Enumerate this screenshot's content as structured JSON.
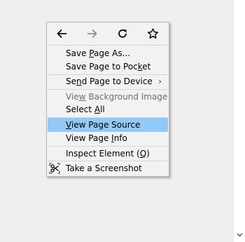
{
  "context_menu": {
    "nav": [
      {
        "name": "back-icon",
        "tooltip": "Back"
      },
      {
        "name": "forward-icon",
        "tooltip": "Forward"
      },
      {
        "name": "reload-icon",
        "tooltip": "Reload"
      },
      {
        "name": "bookmark-star-icon",
        "tooltip": "Bookmark This Page"
      }
    ],
    "items": [
      {
        "label": "Save Page As...",
        "access_key": "P"
      },
      {
        "label": "Save Page to Pocket",
        "access_key": "k"
      },
      {
        "label": "Send Page to Device",
        "access_key": "n",
        "submenu": true
      },
      {
        "label": "View Background Image",
        "access_key": "w",
        "disabled": true
      },
      {
        "label": "Select All",
        "access_key": "A"
      },
      {
        "label": "View Page Source",
        "access_key": "V",
        "highlighted": true
      },
      {
        "label": "View Page Info",
        "access_key": "I"
      },
      {
        "label": "Inspect Element (Q)",
        "access_key": "Q"
      },
      {
        "label": "Take a Screenshot",
        "icon": "screenshot-icon"
      }
    ],
    "submenu_glyph": "›"
  },
  "colors": {
    "highlight": "#91c9f7",
    "menu_bg": "#f2f2f2",
    "disabled_text": "#6d6d6d",
    "page_bg": "#efefef"
  }
}
